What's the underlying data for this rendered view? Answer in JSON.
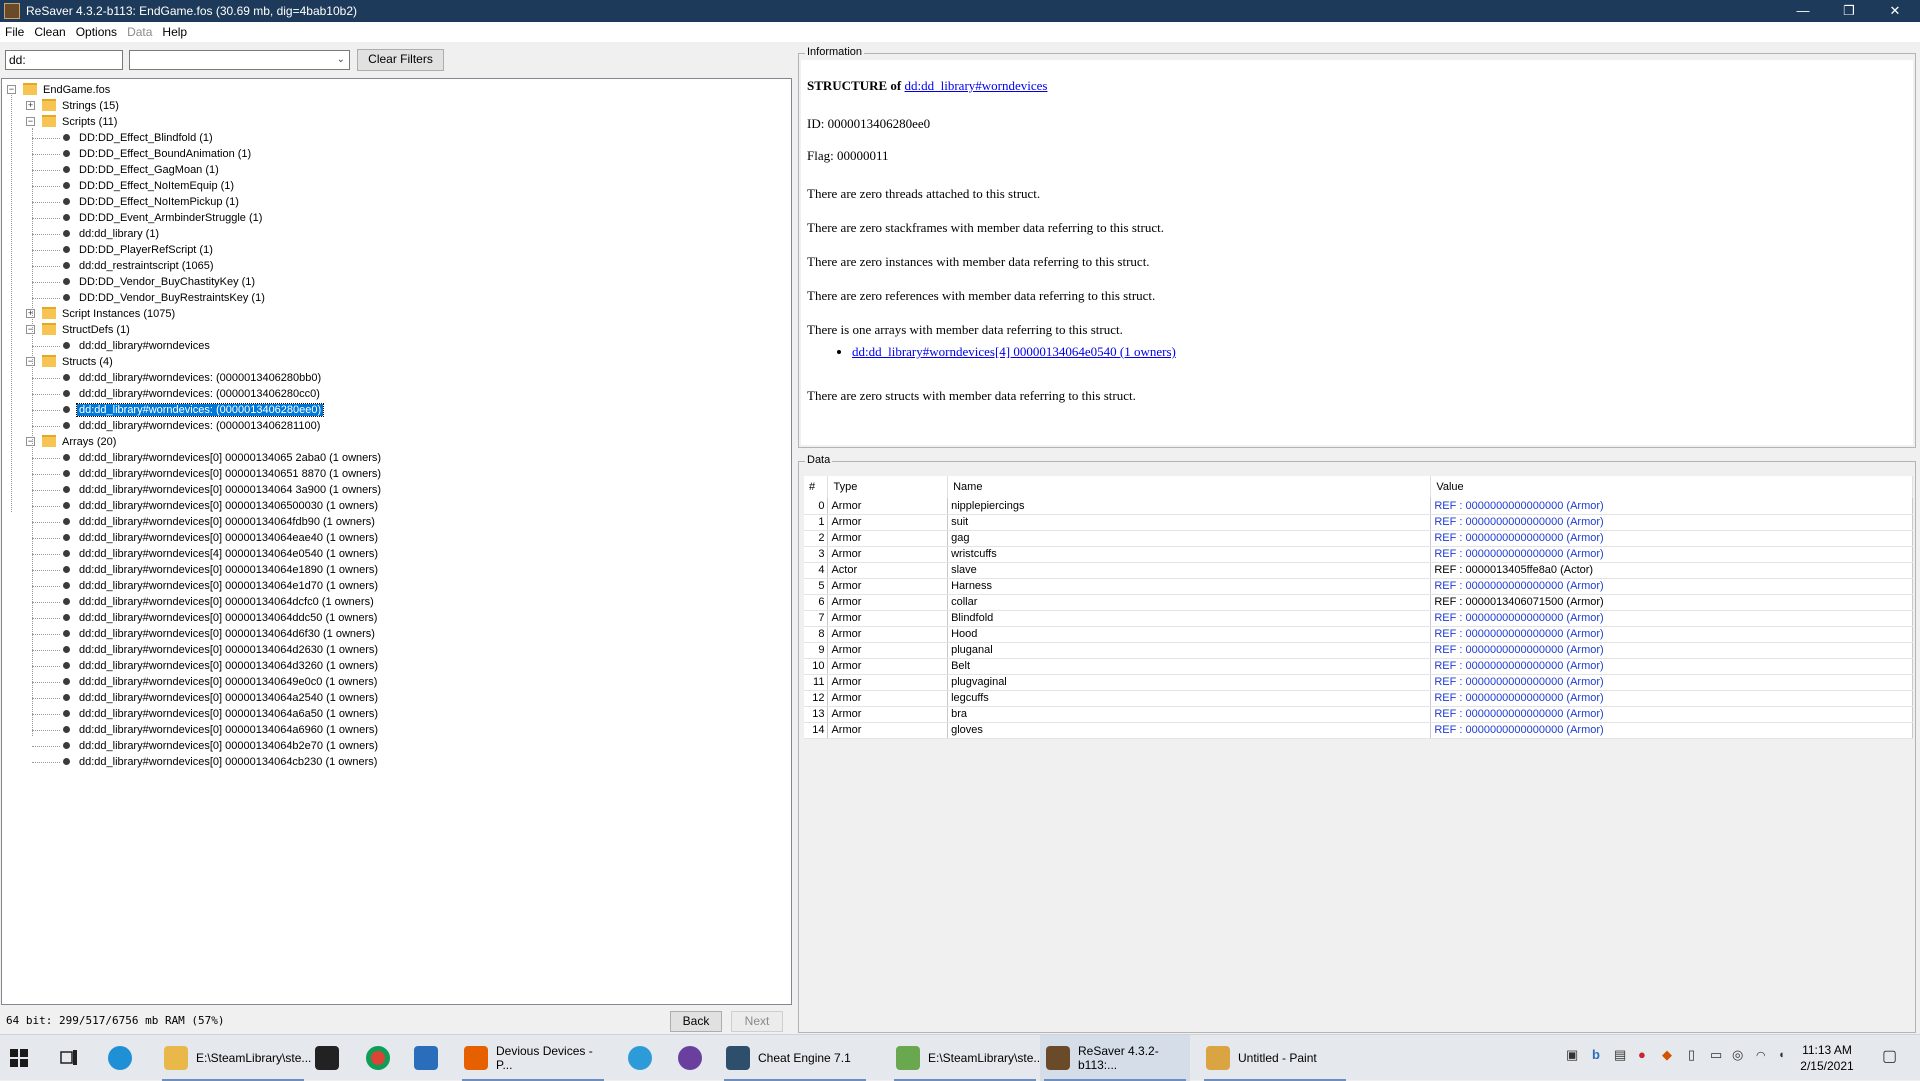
{
  "window": {
    "title": "ReSaver 4.3.2-b113: EndGame.fos (30.69 mb, dig=4bab10b2)",
    "minimize_glyph": "—",
    "maximize_glyph": "❐",
    "close_glyph": "✕"
  },
  "menu": [
    "File",
    "Clean",
    "Options",
    "Data",
    "Help"
  ],
  "filter": {
    "text_value": "dd:",
    "combo_value": "",
    "clear_label": "Clear Filters"
  },
  "tree": {
    "root": "EndGame.fos",
    "strings": "Strings (15)",
    "scripts": "Scripts (11)",
    "script_items": [
      "DD:DD_Effect_Blindfold (1)",
      "DD:DD_Effect_BoundAnimation (1)",
      "DD:DD_Effect_GagMoan (1)",
      "DD:DD_Effect_NoItemEquip (1)",
      "DD:DD_Effect_NoItemPickup (1)",
      "DD:DD_Event_ArmbinderStruggle (1)",
      "dd:dd_library (1)",
      "DD:DD_PlayerRefScript (1)",
      "dd:dd_restraintscript (1065)",
      "DD:DD_Vendor_BuyChastityKey (1)",
      "DD:DD_Vendor_BuyRestraintsKey (1)"
    ],
    "script_instances": "Script Instances (1075)",
    "structdefs": "StructDefs (1)",
    "structdef_items": [
      "dd:dd_library#worndevices"
    ],
    "structs": "Structs (4)",
    "struct_items": [
      "dd:dd_library#worndevices:  (0000013406280bb0)",
      "dd:dd_library#worndevices:  (0000013406280cc0)",
      "dd:dd_library#worndevices:  (0000013406280ee0)",
      "dd:dd_library#worndevices:  (0000013406281100)"
    ],
    "arrays": "Arrays (20)",
    "array_items": [
      "dd:dd_library#worndevices[0] 00000134065 2aba0 (1 owners)",
      "dd:dd_library#worndevices[0] 000001340651 8870 (1 owners)",
      "dd:dd_library#worndevices[0] 00000134064 3a900 (1 owners)",
      "dd:dd_library#worndevices[0] 0000013406500030 (1 owners)",
      "dd:dd_library#worndevices[0] 00000134064fdb90 (1 owners)",
      "dd:dd_library#worndevices[0] 00000134064eae40 (1 owners)",
      "dd:dd_library#worndevices[4] 00000134064e0540 (1 owners)",
      "dd:dd_library#worndevices[0] 00000134064e1890 (1 owners)",
      "dd:dd_library#worndevices[0] 00000134064e1d70 (1 owners)",
      "dd:dd_library#worndevices[0] 00000134064dcfc0 (1 owners)",
      "dd:dd_library#worndevices[0] 00000134064ddc50 (1 owners)",
      "dd:dd_library#worndevices[0] 00000134064d6f30 (1 owners)",
      "dd:dd_library#worndevices[0] 00000134064d2630 (1 owners)",
      "dd:dd_library#worndevices[0] 00000134064d3260 (1 owners)",
      "dd:dd_library#worndevices[0] 000001340649e0c0 (1 owners)",
      "dd:dd_library#worndevices[0] 00000134064a2540 (1 owners)",
      "dd:dd_library#worndevices[0] 00000134064a6a50 (1 owners)",
      "dd:dd_library#worndevices[0] 00000134064a6960 (1 owners)",
      "dd:dd_library#worndevices[0] 00000134064b2e70 (1 owners)",
      "dd:dd_library#worndevices[0] 00000134064cb230 (1 owners)"
    ]
  },
  "status": {
    "memory": "64 bit: 299/517/6756 mb RAM (57%)",
    "back_label": "Back",
    "next_label": "Next"
  },
  "info": {
    "legend": "Information",
    "heading_prefix": "STRUCTURE of",
    "heading_link": "dd:dd_library#worndevices",
    "id_line": "ID: 0000013406280ee0",
    "flag_line": "Flag: 00000011",
    "lines": [
      "There are zero threads attached to this struct.",
      "There are zero stackframes with member data referring to this struct.",
      "There are zero instances with member data referring to this struct.",
      "There are zero references with member data referring to this struct.",
      "There is one arrays with member data referring to this struct."
    ],
    "array_link": "dd:dd_library#worndevices[4] 00000134064e0540 (1 owners)",
    "last_line": "There are zero structs with member data referring to this struct."
  },
  "data": {
    "legend": "Data",
    "columns": [
      "#",
      "Type",
      "Name",
      "Value"
    ],
    "rows": [
      [
        "0",
        "Armor",
        "nipplepiercings",
        "REF : 0000000000000000 (Armor)"
      ],
      [
        "1",
        "Armor",
        "suit",
        "REF : 0000000000000000 (Armor)"
      ],
      [
        "2",
        "Armor",
        "gag",
        "REF : 0000000000000000 (Armor)"
      ],
      [
        "3",
        "Armor",
        "wristcuffs",
        "REF : 0000000000000000 (Armor)"
      ],
      [
        "4",
        "Actor",
        "slave",
        "REF : 0000013405ffe8a0 (Actor)"
      ],
      [
        "5",
        "Armor",
        "Harness",
        "REF : 0000000000000000 (Armor)"
      ],
      [
        "6",
        "Armor",
        "collar",
        "REF : 0000013406071500 (Armor)"
      ],
      [
        "7",
        "Armor",
        "Blindfold",
        "REF : 0000000000000000 (Armor)"
      ],
      [
        "8",
        "Armor",
        "Hood",
        "REF : 0000000000000000 (Armor)"
      ],
      [
        "9",
        "Armor",
        "pluganal",
        "REF : 0000000000000000 (Armor)"
      ],
      [
        "10",
        "Armor",
        "Belt",
        "REF : 0000000000000000 (Armor)"
      ],
      [
        "11",
        "Armor",
        "plugvaginal",
        "REF : 0000000000000000 (Armor)"
      ],
      [
        "12",
        "Armor",
        "legcuffs",
        "REF : 0000000000000000 (Armor)"
      ],
      [
        "13",
        "Armor",
        "bra",
        "REF : 0000000000000000 (Armor)"
      ],
      [
        "14",
        "Armor",
        "gloves",
        "REF : 0000000000000000 (Armor)"
      ]
    ]
  },
  "taskbar": {
    "apps": [
      {
        "label": "E:\\SteamLibrary\\ste...",
        "icon": "folder-icon",
        "color": "#e8b84a"
      },
      {
        "label": "Devious Devices - P...",
        "icon": "firefox-icon",
        "color": "#e66000"
      },
      {
        "label": "Cheat Engine 7.1",
        "icon": "cheat-engine-icon",
        "color": "#2d4f6b"
      },
      {
        "label": "E:\\SteamLibrary\\ste...",
        "icon": "notepad-icon",
        "color": "#6aa84f"
      },
      {
        "label": "ReSaver 4.3.2-b113:...",
        "icon": "resaver-icon",
        "color": "#6b4a2a"
      },
      {
        "label": "Untitled - Paint",
        "icon": "paint-icon",
        "color": "#d9a441"
      }
    ],
    "clock_time": "11:13 AM",
    "clock_date": "2/15/2021"
  }
}
